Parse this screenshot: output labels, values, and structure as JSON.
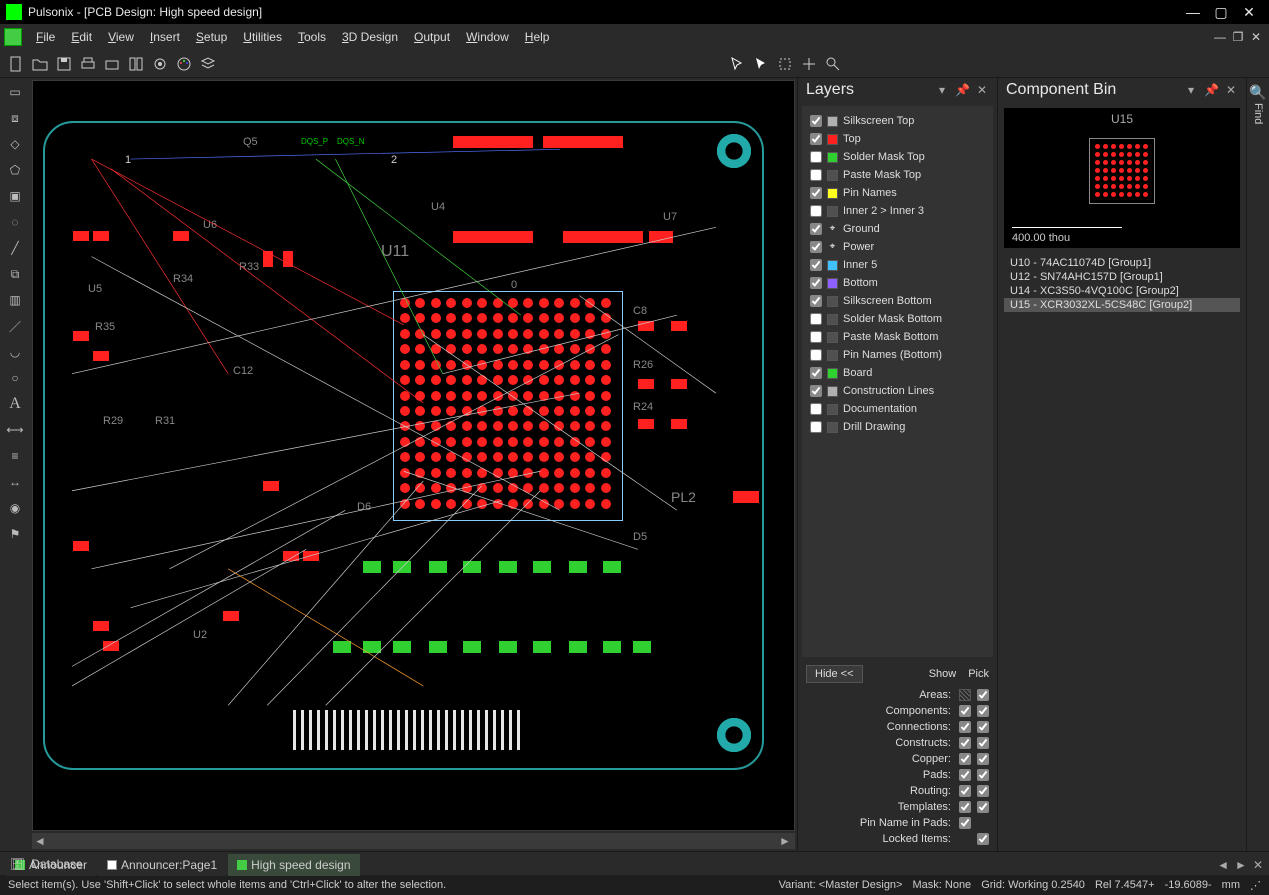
{
  "titlebar": {
    "title": "Pulsonix - [PCB Design: High speed design]"
  },
  "menus": [
    "File",
    "Edit",
    "View",
    "Insert",
    "Setup",
    "Utilities",
    "Tools",
    "3D Design",
    "Output",
    "Window",
    "Help"
  ],
  "tabs": [
    {
      "label": "Announcer",
      "active": false
    },
    {
      "label": "Announcer:Page1",
      "active": false
    },
    {
      "label": "High speed design",
      "active": true
    }
  ],
  "database_label": "Database",
  "layers_panel": {
    "title": "Layers"
  },
  "layers": [
    {
      "name": "Silkscreen Top",
      "checked": true,
      "color": "#b0b0b0"
    },
    {
      "name": "Top",
      "checked": true,
      "color": "#ff2020"
    },
    {
      "name": "Solder Mask Top",
      "checked": false,
      "color": "#30d030"
    },
    {
      "name": "Paste Mask Top",
      "checked": false,
      "color": "#505050"
    },
    {
      "name": "Pin Names",
      "checked": true,
      "color": "#ffff20"
    },
    {
      "name": "Inner 2 > Inner 3",
      "checked": false,
      "color": "#505050"
    },
    {
      "name": "Ground",
      "checked": true,
      "special": "target"
    },
    {
      "name": "Power",
      "checked": true,
      "special": "target"
    },
    {
      "name": "Inner 5",
      "checked": true,
      "color": "#40c0ff"
    },
    {
      "name": "Bottom",
      "checked": true,
      "color": "#9060ff"
    },
    {
      "name": "Silkscreen Bottom",
      "checked": true,
      "color": "#505050"
    },
    {
      "name": "Solder Mask Bottom",
      "checked": false,
      "color": "#505050"
    },
    {
      "name": "Paste Mask Bottom",
      "checked": false,
      "color": "#505050"
    },
    {
      "name": "Pin Names (Bottom)",
      "checked": false,
      "color": "#505050"
    },
    {
      "name": "Board",
      "checked": true,
      "color": "#30d030"
    },
    {
      "name": "Construction Lines",
      "checked": true,
      "color": "#b0b0b0"
    },
    {
      "name": "Documentation",
      "checked": false,
      "color": "#505050"
    },
    {
      "name": "Drill Drawing",
      "checked": false,
      "color": "#505050"
    }
  ],
  "layer_controls": {
    "hide_btn": "Hide <<",
    "show_hdr": "Show",
    "pick_hdr": "Pick",
    "rows": [
      {
        "label": "Areas:",
        "show": "hatch",
        "pick": true
      },
      {
        "label": "Components:",
        "show": true,
        "pick": true
      },
      {
        "label": "Connections:",
        "show": true,
        "pick": true
      },
      {
        "label": "Constructs:",
        "show": true,
        "pick": true
      },
      {
        "label": "Copper:",
        "show": true,
        "pick": true
      },
      {
        "label": "Pads:",
        "show": true,
        "pick": true
      },
      {
        "label": "Routing:",
        "show": true,
        "pick": true
      },
      {
        "label": "Templates:",
        "show": true,
        "pick": true
      },
      {
        "label": "Pin Name in Pads:",
        "show": true,
        "pick": null
      },
      {
        "label": "Locked Items:",
        "show": null,
        "pick": true
      }
    ]
  },
  "compbin": {
    "title": "Component Bin",
    "preview_caption": "U15",
    "preview_dim": "400.00 thou",
    "items": [
      {
        "text": "U10 - 74AC11074D  [Group1]",
        "sel": false
      },
      {
        "text": "U12 - SN74AHC157D  [Group1]",
        "sel": false
      },
      {
        "text": "U14 - XC3S50-4VQ100C  [Group2]",
        "sel": false
      },
      {
        "text": "U15 - XCR3032XL-5CS48C  [Group2]",
        "sel": true
      }
    ]
  },
  "find_label": "Find",
  "status": {
    "hint": "Select item(s). Use 'Shift+Click' to select whole items and 'Ctrl+Click' to alter the selection.",
    "variant": "Variant: <Master Design>",
    "mask": "Mask: None",
    "grid": "Grid: Working 0.2540",
    "rel": "Rel  7.4547+",
    "abs": "-19.6089-",
    "unit": "mm"
  },
  "refs": {
    "q5": "Q5",
    "u4": "U4",
    "u7": "U7",
    "u11": "U11",
    "zero": "0",
    "u5": "U5",
    "u6": "U6",
    "u2": "U2",
    "r33": "R33",
    "r34": "R34",
    "r35": "R35",
    "c12": "C12",
    "c8": "C8",
    "r26": "R26",
    "r24": "R24",
    "d5": "D5",
    "d6": "D6",
    "pl2": "PL2",
    "r29": "R29",
    "r31": "R31",
    "pin1": "1",
    "pin2": "2",
    "dqs_p": "DQS_P",
    "dqs_n": "DQS_N"
  }
}
